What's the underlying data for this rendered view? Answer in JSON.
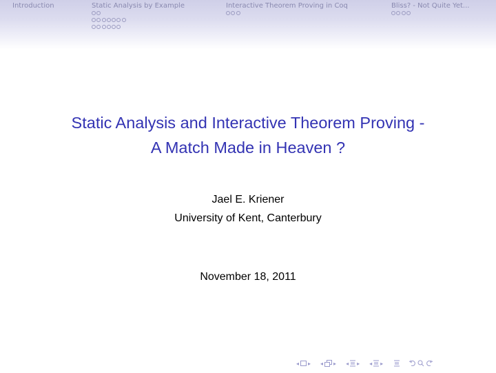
{
  "headline": {
    "sections": [
      {
        "label": "Introduction",
        "subsections": []
      },
      {
        "label": "Static Analysis by Example",
        "subsections": [
          2,
          7,
          6
        ]
      },
      {
        "label": "Interactive Theorem Proving in Coq",
        "subsections": [
          3
        ]
      },
      {
        "label": "Bliss? - Not Quite Yet...",
        "subsections": [
          4
        ]
      }
    ]
  },
  "title": {
    "line1": "Static Analysis and Interactive Theorem Proving -",
    "line2": "A Match Made in Heaven ?"
  },
  "author": {
    "name": "Jael E. Kriener",
    "institute": "University of Kent, Canterbury"
  },
  "date": "November 18, 2011",
  "colors": {
    "title": "#3333b3",
    "headline_text": "#8a8ab0",
    "nav_symbols": "#9a9acc"
  },
  "navigation_symbols": [
    "frame-nav-icon",
    "subsection-nav-icon",
    "section-nav-icon",
    "section-nav-alt-icon",
    "align-icon",
    "back-search-forward-icon"
  ]
}
